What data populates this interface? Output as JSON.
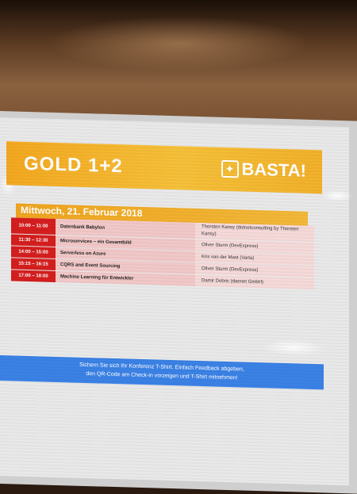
{
  "sign": {
    "room": "GOLD 1+2",
    "brand": "BASTA!",
    "date": "Mittwoch, 21. Februar 2018"
  },
  "sessions": [
    {
      "time": "10:00 – 11:00",
      "title": "Datenbank Babylon",
      "speaker": "Thorsten Kansy (dotnetconsulting by Thorsten Kansy)"
    },
    {
      "time": "11:30 – 12:30",
      "title": "Microservices – ein Gesamtbild",
      "speaker": "Oliver Sturm (DevExpress)"
    },
    {
      "time": "14:00 – 15:00",
      "title": "Serverless on Azure",
      "speaker": "Kris van der Mast (Varta)"
    },
    {
      "time": "15:15 – 16:15",
      "title": "CQRS and Event Sourcing",
      "speaker": "Oliver Sturm (DevExpress)"
    },
    {
      "time": "17:00 – 18:00",
      "title": "Machine Learning für Entwickler",
      "speaker": "Damir Dobric (daenet GmbH)"
    }
  ],
  "banner": {
    "line1": "Sichern Sie sich Ihr Konferenz T-Shirt. Einfach Feedback abgeben,",
    "line2": "den QR-Code am Check-in vorzeigen und T-Shirt mitnehmen!"
  },
  "colors": {
    "header": "#f4a820",
    "time_cell": "#d51e1e",
    "banner": "#3b82e6"
  }
}
